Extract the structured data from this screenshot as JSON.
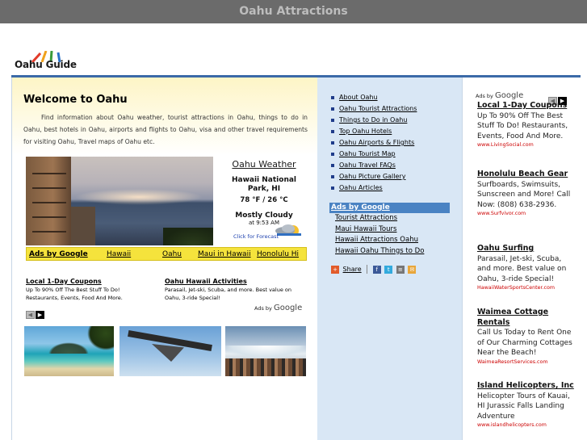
{
  "window": {
    "title": "Oahu Attractions"
  },
  "logo": {
    "text": "Oahu Guide"
  },
  "welcome": {
    "heading": "Welcome to Oahu",
    "body": "Find information about Oahu weather, tourist attractions in Oahu, things to do in Oahu, best hotels in Oahu, airports and flights to Oahu, visa and other travel requirements for visiting Oahu, Travel maps of Oahu etc."
  },
  "weather": {
    "title": "Oahu Weather",
    "location": "Hawaii National Park, HI",
    "temperature": "78 °F / 26 °C",
    "condition": "Mostly Cloudy",
    "time": "at 9:53 AM",
    "forecast_link": "Click for Forecast"
  },
  "adbar": {
    "heading": "Ads by Google",
    "links": [
      "Hawaii",
      "Oahu",
      "Maui in Hawaii",
      "Honolulu Hi"
    ]
  },
  "main_ads": [
    {
      "title": "Local 1-Day Coupons",
      "desc": "Up To 90% Off The Best Stuff To Do! Restaurants, Events, Food And More."
    },
    {
      "title": "Oahu Hawaii Activities",
      "desc": "Parasail, Jet-ski, Scuba, and more. Best value on Oahu, 3-ride Special!"
    }
  ],
  "ads_by": {
    "prefix": "Ads by",
    "brand": "Google"
  },
  "nav_arrows": {
    "prev": "◀",
    "next": "▶"
  },
  "sidebar_links": [
    "About Oahu",
    "Oahu Tourist Attractions",
    "Things to Do in Oahu",
    "Top Oahu Hotels",
    "Oahu Airports & Flights",
    "Oahu Tourist Map",
    "Oahu Travel FAQs",
    "Oahu Picture Gallery",
    "Oahu Articles"
  ],
  "sidebar_ads": {
    "heading": "Ads by Google",
    "links": [
      "Tourist Attractions",
      "Maui Hawaii Tours",
      "Hawaii Attractions Oahu",
      "Hawaii Oahu Things to Do"
    ]
  },
  "share": {
    "label": "Share"
  },
  "right_ads": [
    {
      "title": "Local 1-Day Coupons",
      "desc": "Up To 90% Off The Best Stuff To Do! Restaurants, Events, Food And More.",
      "url": "www.LivingSocial.com"
    },
    {
      "title": "Honolulu Beach Gear",
      "desc": "Surfboards, Swimsuits, Sunscreen and More! Call Now: (808) 638-2936.",
      "url": "www.Surfvivor.com"
    },
    {
      "title": "Oahu Surfing",
      "desc": "Parasail, Jet-ski, Scuba, and more. Best value on Oahu, 3-ride Special!",
      "url": "HawaiiWaterSportsCenter.com"
    },
    {
      "title": "Waimea Cottage Rentals",
      "desc": "Call Us Today to Rent One of Our Charming Cottages Near the Beach!",
      "url": "WaimeaResortServices.com"
    },
    {
      "title": "Island Helicopters, Inc",
      "desc": "Helicopter Tours of Kauai, HI Jurassic Falls Landing Adventure",
      "url": "www.islandhelicopters.com"
    }
  ],
  "colors": {
    "titlebar": "#6b6b6b",
    "accent_blue": "#3b6aa8",
    "ad_yellow": "#f5e33c",
    "sidebar_bg": "#d9e7f5",
    "url_red": "#cc0000"
  }
}
